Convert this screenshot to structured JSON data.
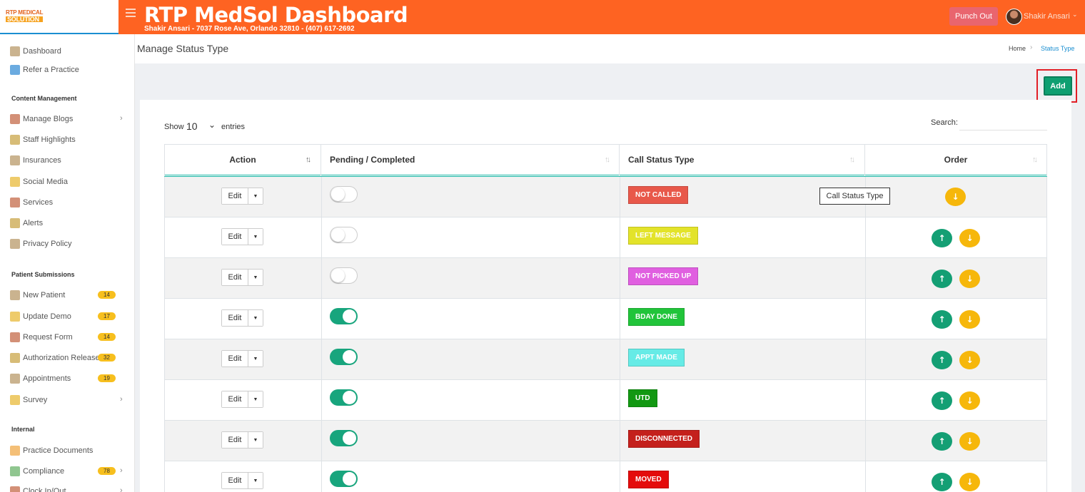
{
  "app": {
    "logo_line1": "RTP MEDICAL",
    "logo_line2": "SOLUTION",
    "title": "RTP MedSol Dashboard",
    "subtitle": "Shakir Ansari - 7037 Rose Ave, Orlando 32810 - (407) 617-2692",
    "punch_out": "Punch Out",
    "user_name": "Shakir Ansari"
  },
  "sidebar": {
    "top": [
      {
        "label": "Dashboard",
        "icon": "dashboard-icon"
      },
      {
        "label": "Refer a Practice",
        "icon": "refer-icon"
      }
    ],
    "content_heading": "Content Management",
    "content": [
      {
        "label": "Manage Blogs",
        "icon": "blogs-icon"
      },
      {
        "label": "Staff Highlights",
        "icon": "staff-icon"
      },
      {
        "label": "Insurances",
        "icon": "insurance-icon"
      },
      {
        "label": "Social Media",
        "icon": "social-icon"
      },
      {
        "label": "Services",
        "icon": "services-icon"
      },
      {
        "label": "Alerts",
        "icon": "alerts-icon"
      },
      {
        "label": "Privacy Policy",
        "icon": "privacy-icon"
      }
    ],
    "patient_heading": "Patient Submissions",
    "patient": [
      {
        "label": "New Patient",
        "badge": "14"
      },
      {
        "label": "Update Demo",
        "badge": "17"
      },
      {
        "label": "Request Form",
        "badge": "14"
      },
      {
        "label": "Authorization Release",
        "badge": "32"
      },
      {
        "label": "Appointments",
        "badge": "19"
      },
      {
        "label": "Survey",
        "badge": ""
      }
    ],
    "internal_heading": "Internal",
    "internal": [
      {
        "label": "Practice Documents",
        "badge": ""
      },
      {
        "label": "Compliance",
        "badge": "78"
      },
      {
        "label": "Clock In/Out",
        "badge": ""
      }
    ]
  },
  "page": {
    "title": "Manage Status Type",
    "breadcrumb_home": "Home",
    "breadcrumb_current": "Status Type",
    "add_label": "Add"
  },
  "table_controls": {
    "show_label": "Show",
    "show_value": "10",
    "entries_label": "entries",
    "search_label": "Search:"
  },
  "table": {
    "headers": [
      "Action",
      "Pending / Completed",
      "Call Status Type",
      "Order"
    ],
    "edit_label": "Edit",
    "tooltip": "Call Status Type",
    "rows": [
      {
        "status": "NOT CALLED",
        "color": "#e8584a",
        "completed": false
      },
      {
        "status": "LEFT MESSAGE",
        "color": "#e3e32a",
        "completed": false
      },
      {
        "status": "NOT PICKED UP",
        "color": "#e05fe0",
        "completed": false
      },
      {
        "status": "BDAY DONE",
        "color": "#21c43a",
        "completed": true
      },
      {
        "status": "APPT MADE",
        "color": "#66ebe6",
        "completed": true
      },
      {
        "status": "UTD",
        "color": "#129812",
        "completed": true
      },
      {
        "status": "DISCONNECTED",
        "color": "#c4201c",
        "completed": true
      },
      {
        "status": "MOVED",
        "color": "#e40c0c",
        "completed": true
      }
    ]
  }
}
